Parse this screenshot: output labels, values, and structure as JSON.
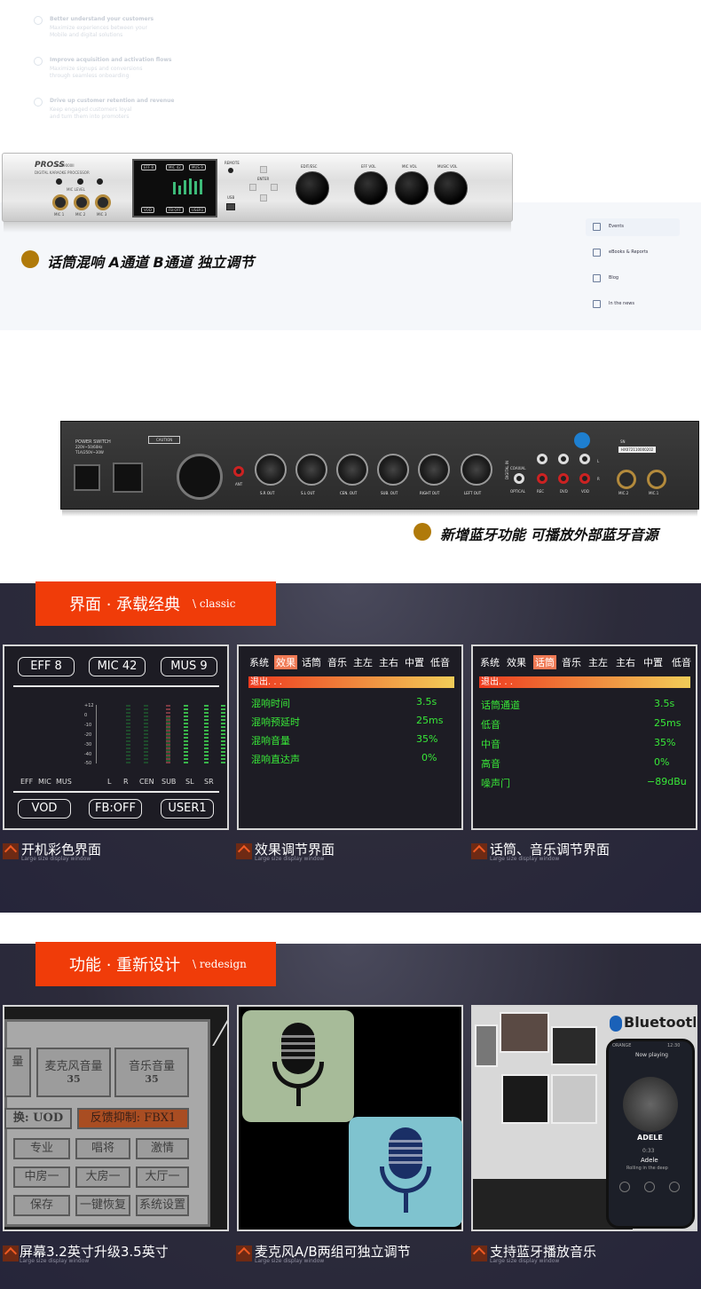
{
  "top_web": {
    "rows": [
      {
        "title": "Better understand your customers",
        "sub1": "Maximize experiences between your",
        "sub2": "Mobile and digital solutions"
      },
      {
        "title": "Improve acquisition and activation flows",
        "sub1": "Maximize signups and conversions",
        "sub2": "through seamless onboarding"
      },
      {
        "title": "Drive up customer retention and revenue",
        "sub1": "Keep engaged customers loyal",
        "sub2": "and turn them into promoters"
      }
    ],
    "nav": [
      "Events",
      "eBooks & Reports",
      "Blog",
      "In the news"
    ]
  },
  "front_panel": {
    "brand": "PROSS",
    "model": "DSP9000II",
    "subtitle": "DIGITAL KARAOKE PROCESSOR",
    "mic_level": "MIC LEVEL",
    "mic_jacks": [
      "MIC 1",
      "MIC 2",
      "MIC 3"
    ],
    "lcd_tags": [
      "EFF 8",
      "MIC 42",
      "MUS 9"
    ],
    "lcd_buttons": [
      "VOD",
      "FB:OFF",
      "USER1"
    ],
    "remote": "REMOTE",
    "usb": "USB",
    "enter": "ENTER",
    "knobs": [
      "EDIT/ESC",
      "EFF VOL",
      "MIC VOL",
      "MUSIC VOL"
    ],
    "caption": "话筒混响 A通道 B通道 独立调节"
  },
  "rear_panel": {
    "power_switch": "POWER SWITCH",
    "power_spec1": "220V~50/60Hz",
    "power_spec2": "T1A/250V~30W",
    "caution": "CAUTION",
    "ant": "ANT",
    "outputs": [
      "S.R OUT",
      "S.L OUT",
      "CEN. OUT",
      "SUB. OUT",
      "RIGHT OUT",
      "LEFT OUT"
    ],
    "digital_in": "DIGITAL IN",
    "coaxial": "COAXIAL",
    "optical": "OPTICAL",
    "rca_labels": [
      "REC",
      "DVD",
      "VOD"
    ],
    "l": "L",
    "r": "R",
    "sn_label": "SN",
    "sn": "HX072110000202",
    "mics": [
      "MIC.2",
      "MIC.1"
    ],
    "caption": "新增蓝牙功能 可播放外部蓝牙音源"
  },
  "section1": {
    "banner_title": "界面 · 承载经典",
    "banner_sub": "\\ classic",
    "panel1": {
      "tags": [
        "EFF 8",
        "MIC 42",
        "MUS 9"
      ],
      "scale": [
        "+12",
        "0",
        "-10",
        "-20",
        "-30",
        "-40",
        "-50"
      ],
      "left_labels": [
        "EFF",
        "MIC",
        "MUS"
      ],
      "chan_labels": [
        "L",
        "R",
        "CEN",
        "SUB",
        "SL",
        "SR"
      ],
      "buttons": [
        "VOD",
        "FB:OFF",
        "USER1"
      ]
    },
    "panel2": {
      "menu": [
        "系统",
        "效果",
        "话筒",
        "音乐",
        "主左",
        "主右",
        "中置",
        "低音"
      ],
      "selected": "效果",
      "exit": "退出. . .",
      "rows": [
        {
          "label": "混响时间",
          "value": "3.5s"
        },
        {
          "label": "混响预延时",
          "value": "25ms"
        },
        {
          "label": "混响音量",
          "value": "35%"
        },
        {
          "label": "混响直达声",
          "value": "0%"
        }
      ]
    },
    "panel3": {
      "menu": [
        "系统",
        "效果",
        "话筒",
        "音乐",
        "主左",
        "主右",
        "中置",
        "低音"
      ],
      "selected": "话筒",
      "exit": "退出. . .",
      "rows": [
        {
          "label": "话筒通道",
          "value": "3.5s"
        },
        {
          "label": "低音",
          "value": "25ms"
        },
        {
          "label": "中音",
          "value": "35%"
        },
        {
          "label": "高音",
          "value": "0%"
        },
        {
          "label": "噪声门",
          "value": "−89dBu"
        }
      ]
    },
    "captions": [
      {
        "main": "开机彩色界面",
        "sub": "Large size display window"
      },
      {
        "main": "效果调节界面",
        "sub": "Large size display window"
      },
      {
        "main": "话筒、音乐调节界面",
        "sub": "Large size display window"
      }
    ]
  },
  "section2": {
    "banner_title": "功能 · 重新设计",
    "banner_sub": "\\ redesign",
    "panel4": {
      "row1": [
        "量",
        "麦克风音量",
        "音乐音量"
      ],
      "row1_values": [
        "35",
        "35"
      ],
      "row2_left": "换: UOD",
      "row2_right": "反馈抑制: FBX1",
      "row3": [
        "专业",
        "唱将",
        "激情"
      ],
      "row4": [
        "中房一",
        "大房一",
        "大厅一"
      ],
      "row5": [
        "保存",
        "一键恢复",
        "系统设置"
      ]
    },
    "panel6": {
      "bluetooth": "Bluetooth",
      "now_playing": "Now playing",
      "carrier": "ORANGE",
      "time_status": "12:30",
      "cover_text": "ADELE",
      "time": "0:33",
      "artist": "Adele",
      "song": "Rolling in the deep"
    },
    "captions": [
      {
        "main": "屏幕3.2英寸升级3.5英寸",
        "sub": "Large size display window"
      },
      {
        "main": "麦克风A/B两组可独立调节",
        "sub": "Large size display window"
      },
      {
        "main": "支持蓝牙播放音乐",
        "sub": "Large size display window"
      }
    ]
  },
  "colors": {
    "accent": "#f03c09",
    "bullet": "#b07a0a",
    "green_text": "#38e838",
    "mic_card_1": "#a7bb99",
    "mic_card_2": "#7fc3cf"
  }
}
